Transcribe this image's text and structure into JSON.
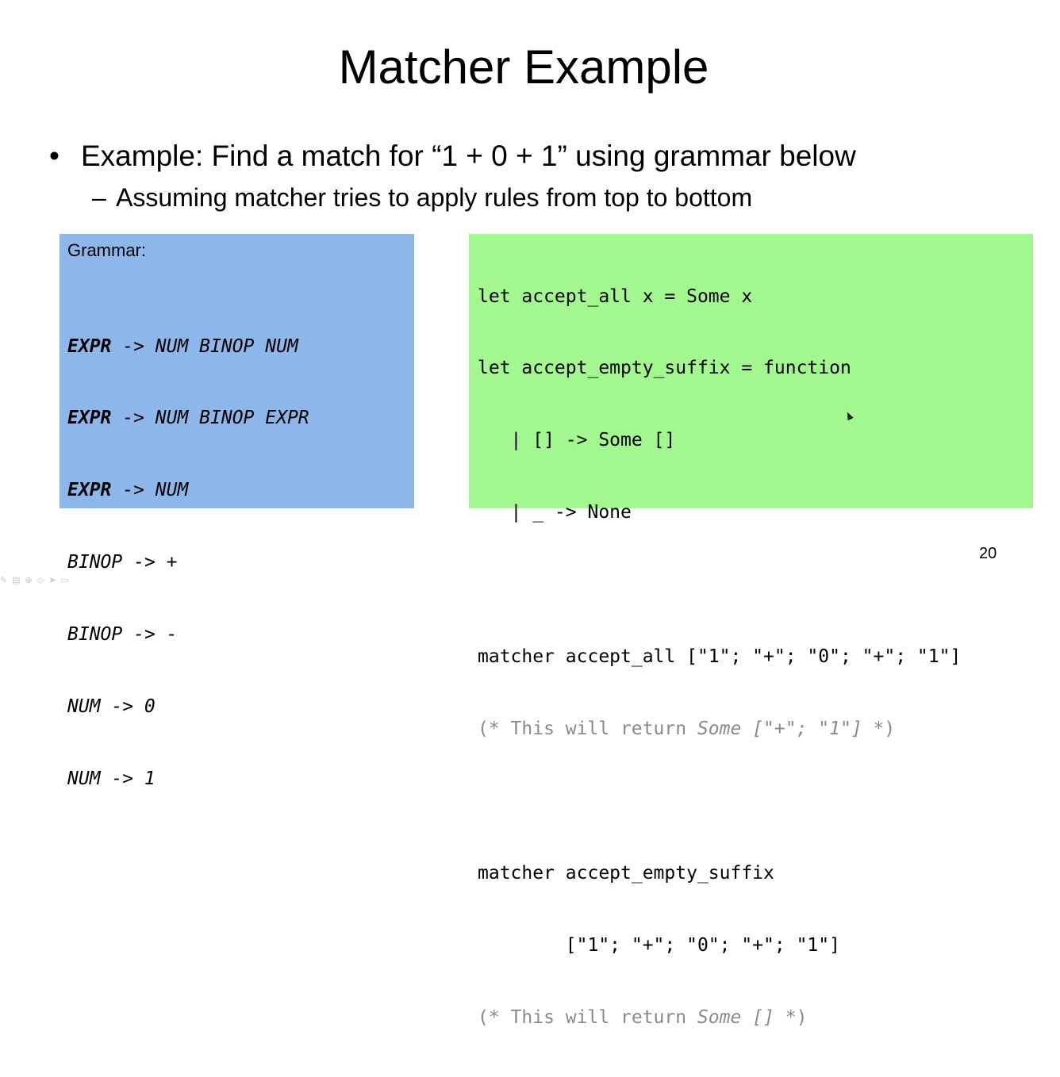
{
  "slide": {
    "title": "Matcher Example",
    "bullet": "Example: Find a match for “1 + 0 + 1” using grammar below",
    "sub_bullet": "Assuming matcher tries to apply rules from top to bottom",
    "page_number": "20"
  },
  "grammar": {
    "heading": "Grammar:",
    "rules": [
      {
        "lhs": "EXPR",
        "rhs": " -> NUM BINOP NUM"
      },
      {
        "lhs": "EXPR",
        "rhs": " -> NUM BINOP EXPR"
      },
      {
        "lhs": "EXPR",
        "rhs": " -> NUM"
      },
      {
        "lhs": "BINOP",
        "rhs": " -> +"
      },
      {
        "lhs": "BINOP",
        "rhs": " -> -"
      },
      {
        "lhs": "NUM",
        "rhs": " -> 0"
      },
      {
        "lhs": "NUM",
        "rhs": " -> 1"
      }
    ]
  },
  "code": {
    "line1": "let accept_all x = Some x",
    "line2": "let accept_empty_suffix = function",
    "line3": "   | [] -> Some []",
    "line4": "   | _ -> None",
    "line5": "matcher accept_all [\"1\"; \"+\"; \"0\"; \"+\"; \"1\"]",
    "comment1_a": "(* This will return ",
    "comment1_b": "Some [\"+\"; \"1\"]",
    "comment1_c": " *)",
    "line6": "matcher accept_empty_suffix",
    "line7": "        [\"1\"; \"+\"; \"0\"; \"+\"; \"1\"]",
    "comment2_a": "(* This will return ",
    "comment2_b": "Some []",
    "comment2_c": " *)"
  },
  "colors": {
    "grammar_bg": "#8db6ea",
    "code_bg": "#a3f78f",
    "comment": "#8a8a8a"
  }
}
